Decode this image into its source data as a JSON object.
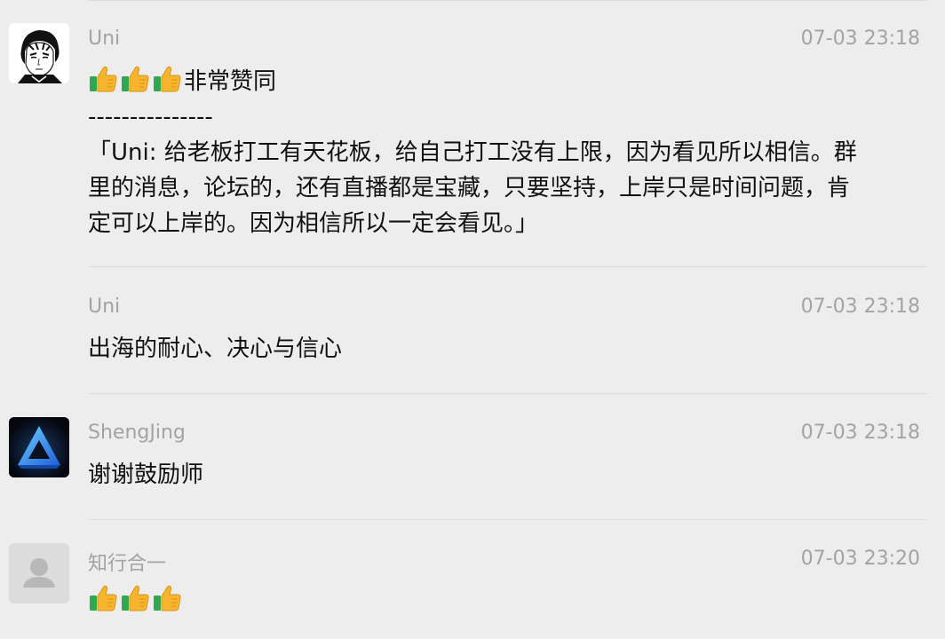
{
  "messages": [
    {
      "sender": "Uni",
      "time": "07-03 23:18",
      "text_after_emoji": "非常赞同",
      "separator": "---------------",
      "quote_lines": [
        "「Uni: 给老板打工有天花板，给自己打工没有上限，因为看见所以相信。群",
        "里的消息，论坛的，还有直播都是宝藏，只要坚持，上岸只是时间问题，肯",
        "定可以上岸的。因为相信所以一定会看见。」"
      ],
      "emoji": "thumbs-up",
      "emoji_count": 3
    },
    {
      "sender": "Uni",
      "time": "07-03 23:18",
      "text": "出海的耐心、决心与信心"
    },
    {
      "sender": "ShengJing",
      "time": "07-03 23:18",
      "text": "谢谢鼓励师"
    },
    {
      "sender": "知行合一",
      "time": "07-03 23:20",
      "emoji": "thumbs-up",
      "emoji_count": 3
    }
  ],
  "colors": {
    "background": "#ededed",
    "meta_text": "#a3a3a3",
    "body_text": "#111111",
    "divider": "#dcdcdc",
    "thumb_yellow": "#f6b52c",
    "cuff_green": "#2fa84f",
    "triangle_blue": "#2d8be8"
  }
}
